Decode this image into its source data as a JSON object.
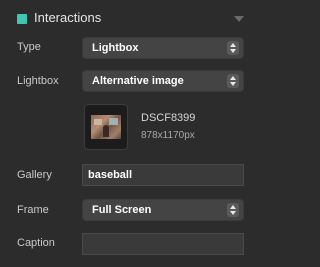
{
  "header": {
    "title": "Interactions",
    "accent": "#3fc7b2"
  },
  "fields": {
    "type": {
      "label": "Type",
      "value": "Lightbox"
    },
    "lightbox": {
      "label": "Lightbox",
      "value": "Alternative image"
    },
    "image": {
      "filename": "DSCF8399",
      "dimensions": "878x1170px"
    },
    "gallery": {
      "label": "Gallery",
      "value": "baseball"
    },
    "frame": {
      "label": "Frame",
      "value": "Full Screen"
    },
    "caption": {
      "label": "Caption",
      "value": ""
    }
  }
}
